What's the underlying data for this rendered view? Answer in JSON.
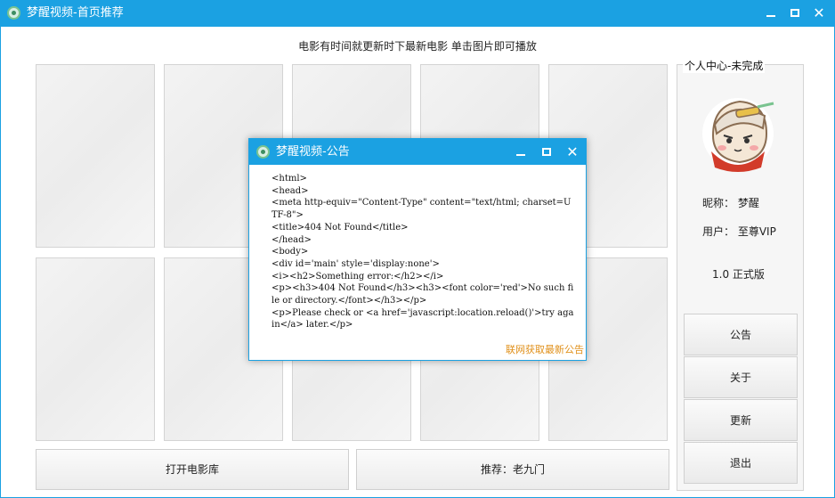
{
  "window": {
    "title": "梦醒视频-首页推荐"
  },
  "main": {
    "hint": "电影有时间就更新时下最新电影   单击图片即可播放",
    "open_library_label": "打开电影库",
    "recommend_label": "推荐：老九门"
  },
  "user_panel": {
    "title": "个人中心-未完成",
    "nickname": "昵称： 梦醒",
    "user_type": "用户： 至尊VIP",
    "version": "1.0 正式版",
    "buttons": [
      "公告",
      "关于",
      "更新",
      "退出"
    ]
  },
  "dialog": {
    "title": "梦醒视频-公告",
    "content": "<html>\n<head>\n<meta http-equiv=\"Content-Type\" content=\"text/html; charset=UTF-8\">\n<title>404 Not Found</title>\n</head>\n<body>\n<div id='main' style='display:none'>\n<i><h2>Something error:</h2></i>\n<p><h3>404 Not Found</h3><h3><font color='red'>No such file or directory.</font></h3></p>\n<p>Please check or <a href='javascript:location.reload()'>try again</a> later.</p>",
    "link": "联网获取最新公告"
  },
  "icons": {
    "app": "app-logo-icon",
    "minimize": "minimize-icon",
    "maximize": "maximize-icon",
    "close": "close-icon"
  },
  "colors": {
    "titlebar": "#1ba1e2",
    "link": "#e0901a"
  }
}
